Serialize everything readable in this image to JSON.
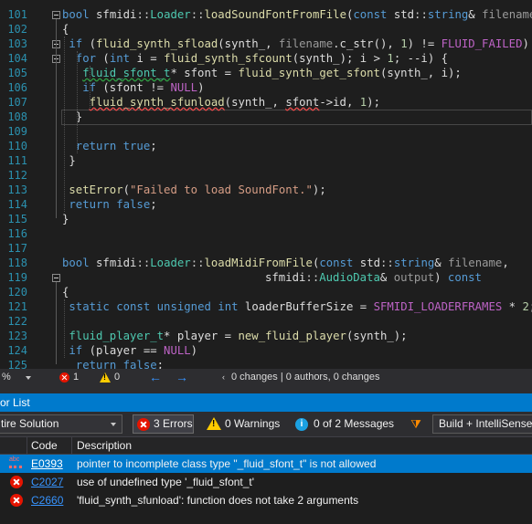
{
  "colors": {
    "accent": "#007acc",
    "error": "#e51400",
    "warning": "#ffcc00",
    "info": "#1ba1e2",
    "editor_bg": "#1e1e1e"
  },
  "editor": {
    "lines": [
      {
        "num": "101",
        "tokens": [
          [
            "kw",
            "bool"
          ],
          [
            "",
            "&nbsp;sfmidi"
          ],
          [
            "ns",
            "::"
          ],
          [
            "ty",
            "Loader"
          ],
          [
            "ns",
            "::"
          ],
          [
            "fn",
            "loadSoundFontFromFile"
          ],
          [
            "",
            "("
          ],
          [
            "kw",
            "const"
          ],
          [
            "",
            ""
          ],
          [
            "",
            "&nbsp;std"
          ],
          [
            "ns",
            "::"
          ],
          [
            "kw",
            "string"
          ],
          [
            "",
            "&amp;&nbsp;"
          ],
          [
            "pm",
            "filename"
          ],
          [
            "",
            ")"
          ]
        ]
      },
      {
        "num": "102",
        "tokens": [
          [
            "",
            "{"
          ]
        ]
      },
      {
        "num": "103",
        "tokens": [
          [
            "kw",
            "if"
          ],
          [
            "",
            "&nbsp;("
          ],
          [
            "fn",
            "fluid_synth_sfload"
          ],
          [
            "",
            "(synth_,&nbsp;"
          ],
          [
            "pm",
            "filename"
          ],
          [
            "",
            ".c_str(),&nbsp;"
          ],
          [
            "nm",
            "1"
          ],
          [
            "",
            ")&nbsp;!=&nbsp;"
          ],
          [
            "mc",
            "FLUID_FAILED"
          ],
          [
            "",
            ")&nbsp;{"
          ]
        ]
      },
      {
        "num": "104",
        "tokens": [
          [
            "kw",
            "for"
          ],
          [
            "",
            "&nbsp;("
          ],
          [
            "kw",
            "int"
          ],
          [
            "",
            "&nbsp;i&nbsp;=&nbsp;"
          ],
          [
            "fn",
            "fluid_synth_sfcount"
          ],
          [
            "",
            "(synth_);&nbsp;i&nbsp;&gt;&nbsp;"
          ],
          [
            "nm",
            "1"
          ],
          [
            "",
            "; --i) {"
          ]
        ]
      },
      {
        "num": "105",
        "tokens": [
          [
            "ty sqg",
            "fluid_sfont_t"
          ],
          [
            "",
            "*&nbsp;sfont&nbsp;=&nbsp;"
          ],
          [
            "fn",
            "fluid_synth_get_sfont"
          ],
          [
            "",
            "(synth_,&nbsp;i);"
          ]
        ]
      },
      {
        "num": "106",
        "tokens": [
          [
            "kw",
            "if"
          ],
          [
            "",
            "&nbsp;(sfont&nbsp;!=&nbsp;"
          ],
          [
            "mc",
            "NULL"
          ],
          [
            "",
            ")"
          ]
        ]
      },
      {
        "num": "107",
        "tokens": [
          [
            "fn sq",
            "fluid_synth_sfunload"
          ],
          [
            "",
            "(synth_,&nbsp;"
          ],
          [
            "sq",
            "sfont"
          ],
          [
            "",
            "-&gt;id,&nbsp;"
          ],
          [
            "nm",
            "1"
          ],
          [
            "",
            ");"
          ]
        ]
      },
      {
        "num": "108",
        "tokens": [
          [
            "",
            "}"
          ]
        ]
      },
      {
        "num": "109",
        "tokens": []
      },
      {
        "num": "110",
        "tokens": [
          [
            "kw",
            "return"
          ],
          [
            "",
            "&nbsp;"
          ],
          [
            "kw",
            "true"
          ],
          [
            "",
            ";"
          ]
        ]
      },
      {
        "num": "111",
        "tokens": [
          [
            "",
            "}"
          ]
        ]
      },
      {
        "num": "112",
        "tokens": []
      },
      {
        "num": "113",
        "tokens": [
          [
            "fn",
            "setError"
          ],
          [
            "",
            "("
          ],
          [
            "st",
            "\"Failed to load SoundFont.\""
          ],
          [
            "",
            ");"
          ]
        ]
      },
      {
        "num": "114",
        "tokens": [
          [
            "kw",
            "return"
          ],
          [
            "",
            "&nbsp;"
          ],
          [
            "kw",
            "false"
          ],
          [
            "",
            ";"
          ]
        ]
      },
      {
        "num": "115",
        "tokens": [
          [
            "",
            "}"
          ]
        ]
      },
      {
        "num": "116",
        "tokens": []
      },
      {
        "num": "117",
        "tokens": []
      },
      {
        "num": "118",
        "tokens": [
          [
            "kw",
            "bool"
          ],
          [
            "",
            "&nbsp;sfmidi"
          ],
          [
            "ns",
            "::"
          ],
          [
            "ty",
            "Loader"
          ],
          [
            "ns",
            "::"
          ],
          [
            "fn",
            "loadMidiFromFile"
          ],
          [
            "",
            "("
          ],
          [
            "kw",
            "const"
          ],
          [
            "",
            "&nbsp;std"
          ],
          [
            "ns",
            "::"
          ],
          [
            "kw",
            "string"
          ],
          [
            "",
            "&amp;&nbsp;"
          ],
          [
            "pm",
            "filename"
          ],
          [
            "",
            ","
          ]
        ]
      },
      {
        "num": "119",
        "tokens": [
          [
            "",
            "sfmidi"
          ],
          [
            "ns",
            "::"
          ],
          [
            "ty",
            "AudioData"
          ],
          [
            "",
            "&amp;&nbsp;"
          ],
          [
            "pm",
            "output"
          ],
          [
            "",
            ")&nbsp;"
          ],
          [
            "kw",
            "const"
          ]
        ]
      },
      {
        "num": "120",
        "tokens": [
          [
            "",
            "{"
          ]
        ]
      },
      {
        "num": "121",
        "tokens": [
          [
            "kw",
            "static"
          ],
          [
            "",
            "&nbsp;"
          ],
          [
            "kw",
            "const"
          ],
          [
            "",
            "&nbsp;"
          ],
          [
            "kw",
            "unsigned"
          ],
          [
            "",
            "&nbsp;"
          ],
          [
            "kw",
            "int"
          ],
          [
            "",
            "&nbsp;loaderBufferSize&nbsp;=&nbsp;"
          ],
          [
            "mc",
            "SFMIDI_LOADERFRAMES"
          ],
          [
            "",
            "&nbsp;*&nbsp;"
          ],
          [
            "nm",
            "2"
          ],
          [
            "",
            ";"
          ]
        ]
      },
      {
        "num": "122",
        "tokens": []
      },
      {
        "num": "123",
        "tokens": [
          [
            "ty",
            "fluid_player_t"
          ],
          [
            "",
            "*&nbsp;player&nbsp;=&nbsp;"
          ],
          [
            "fn",
            "new_fluid_player"
          ],
          [
            "",
            "(synth_);"
          ]
        ]
      },
      {
        "num": "124",
        "tokens": [
          [
            "kw",
            "if"
          ],
          [
            "",
            "&nbsp;(player&nbsp;==&nbsp;"
          ],
          [
            "mc",
            "NULL"
          ],
          [
            "",
            ")"
          ]
        ]
      },
      {
        "num": "125",
        "tokens": [
          [
            "kw",
            "return"
          ],
          [
            "",
            "&nbsp;"
          ],
          [
            "kw",
            "false"
          ],
          [
            "",
            ";"
          ]
        ]
      }
    ]
  },
  "status_strip": {
    "zoom": "%",
    "errors": "1",
    "warnings": "0",
    "changes": "0 changes | 0 authors, 0 changes"
  },
  "error_list": {
    "title": "or List",
    "scope": "tire Solution",
    "errors_label": "3 Errors",
    "warnings_label": "0 Warnings",
    "messages_label": "0 of 2 Messages",
    "build_label": "Build + IntelliSense",
    "columns": {
      "code": "Code",
      "description": "Description"
    },
    "rows": [
      {
        "code": "E0393",
        "description": "pointer to incomplete class type \"_fluid_sfont_t\" is not allowed",
        "icon": "intellisense-error-icon"
      },
      {
        "code": "C2027",
        "description": "use of undefined type '_fluid_sfont_t'",
        "icon": "error-icon"
      },
      {
        "code": "C2660",
        "description": "'fluid_synth_sfunload': function does not take 2 arguments",
        "icon": "error-icon"
      }
    ]
  }
}
